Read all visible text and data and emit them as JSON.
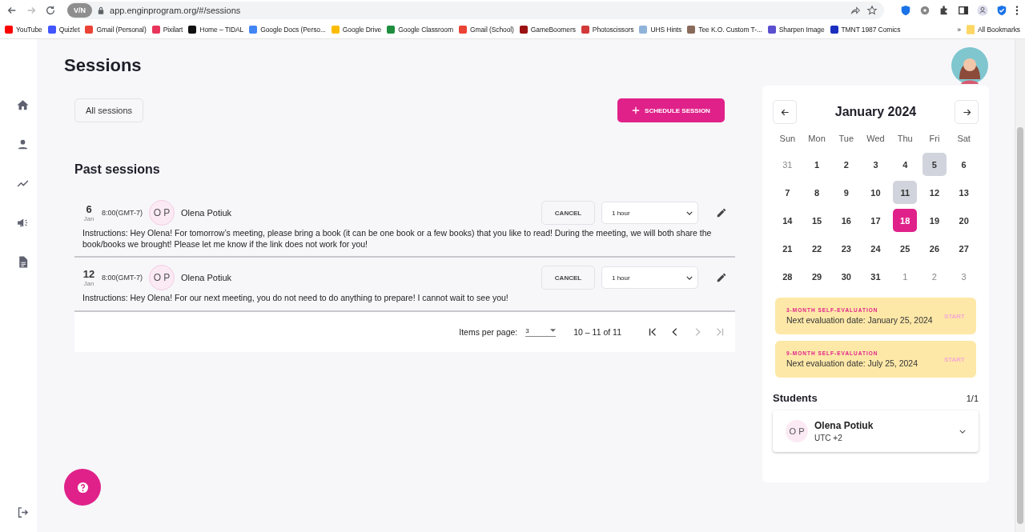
{
  "browser": {
    "url": "app.enginprogram.org/#/sessions",
    "vpn_badge": "V/N",
    "bookmarks": [
      {
        "label": "YouTube",
        "color": "#ff0000"
      },
      {
        "label": "Quizlet",
        "color": "#4255ff"
      },
      {
        "label": "Gmail (Personal)",
        "color": "#ea4335"
      },
      {
        "label": "Pixilart",
        "color": "#e8345a"
      },
      {
        "label": "Home – TIDAL",
        "color": "#111111"
      },
      {
        "label": "Google Docs (Perso...",
        "color": "#4285f4"
      },
      {
        "label": "Google Drive",
        "color": "#fbbc04"
      },
      {
        "label": "Google Classroom",
        "color": "#1e8e3e"
      },
      {
        "label": "Gmail (School)",
        "color": "#ea4335"
      },
      {
        "label": "GameBoomers",
        "color": "#9b1111"
      },
      {
        "label": "Photoscissors",
        "color": "#d23a3a"
      },
      {
        "label": "UHS Hints",
        "color": "#8fb3d9"
      },
      {
        "label": "Tee K.O. Custom T-...",
        "color": "#8a6a5a"
      },
      {
        "label": "Sharpen Image",
        "color": "#5a4fcf"
      },
      {
        "label": "TMNT 1987 Comics",
        "color": "#1a2fbf"
      }
    ],
    "overflow": "»",
    "all_bookmarks": "All Bookmarks"
  },
  "page": {
    "title": "Sessions"
  },
  "filter_button": "All sessions",
  "schedule_button": "SCHEDULE SESSION",
  "past_heading": "Past sessions",
  "sessions": [
    {
      "day": "6",
      "month": "Jan",
      "time": "8:00(GMT-7)",
      "initials": "O P",
      "name": "Olena Potiuk",
      "cancel": "CANCEL",
      "duration": "1 hour",
      "instructions": "Instructions: Hey Olena! For tomorrow’s meeting, please bring a book (it can be one book or a few books) that you like to read! During the meeting, we will both share the book/books we brought! Please let me know if the link does not work for you!"
    },
    {
      "day": "12",
      "month": "Jan",
      "time": "8:00(GMT-7)",
      "initials": "O P",
      "name": "Olena Potiuk",
      "cancel": "CANCEL",
      "duration": "1 hour",
      "instructions": "Instructions: Hey Olena! For our next meeting, you do not need to do anything to prepare! I cannot wait to see you!"
    }
  ],
  "pagination": {
    "label": "Items per page:",
    "per_page": "3",
    "range": "10 – 11 of 11"
  },
  "calendar": {
    "title": "January 2024",
    "weekdays": [
      "Sun",
      "Mon",
      "Tue",
      "Wed",
      "Thu",
      "Fri",
      "Sat"
    ],
    "days": [
      {
        "label": "31",
        "outside": true,
        "marked": false,
        "selected": false
      },
      {
        "label": "1",
        "outside": false,
        "marked": false,
        "selected": false
      },
      {
        "label": "2",
        "outside": false,
        "marked": false,
        "selected": false
      },
      {
        "label": "3",
        "outside": false,
        "marked": false,
        "selected": false
      },
      {
        "label": "4",
        "outside": false,
        "marked": false,
        "selected": false
      },
      {
        "label": "5",
        "outside": false,
        "marked": true,
        "selected": false
      },
      {
        "label": "6",
        "outside": false,
        "marked": false,
        "selected": false
      },
      {
        "label": "7",
        "outside": false,
        "marked": false,
        "selected": false
      },
      {
        "label": "8",
        "outside": false,
        "marked": false,
        "selected": false
      },
      {
        "label": "9",
        "outside": false,
        "marked": false,
        "selected": false
      },
      {
        "label": "10",
        "outside": false,
        "marked": false,
        "selected": false
      },
      {
        "label": "11",
        "outside": false,
        "marked": true,
        "selected": false
      },
      {
        "label": "12",
        "outside": false,
        "marked": false,
        "selected": false
      },
      {
        "label": "13",
        "outside": false,
        "marked": false,
        "selected": false
      },
      {
        "label": "14",
        "outside": false,
        "marked": false,
        "selected": false
      },
      {
        "label": "15",
        "outside": false,
        "marked": false,
        "selected": false
      },
      {
        "label": "16",
        "outside": false,
        "marked": false,
        "selected": false
      },
      {
        "label": "17",
        "outside": false,
        "marked": false,
        "selected": false
      },
      {
        "label": "18",
        "outside": false,
        "marked": false,
        "selected": true
      },
      {
        "label": "19",
        "outside": false,
        "marked": false,
        "selected": false
      },
      {
        "label": "20",
        "outside": false,
        "marked": false,
        "selected": false
      },
      {
        "label": "21",
        "outside": false,
        "marked": false,
        "selected": false
      },
      {
        "label": "22",
        "outside": false,
        "marked": false,
        "selected": false
      },
      {
        "label": "23",
        "outside": false,
        "marked": false,
        "selected": false
      },
      {
        "label": "24",
        "outside": false,
        "marked": false,
        "selected": false
      },
      {
        "label": "25",
        "outside": false,
        "marked": false,
        "selected": false
      },
      {
        "label": "26",
        "outside": false,
        "marked": false,
        "selected": false
      },
      {
        "label": "27",
        "outside": false,
        "marked": false,
        "selected": false
      },
      {
        "label": "28",
        "outside": false,
        "marked": false,
        "selected": false
      },
      {
        "label": "29",
        "outside": false,
        "marked": false,
        "selected": false
      },
      {
        "label": "30",
        "outside": false,
        "marked": false,
        "selected": false
      },
      {
        "label": "31",
        "outside": false,
        "marked": false,
        "selected": false
      },
      {
        "label": "1",
        "outside": true,
        "marked": false,
        "selected": false
      },
      {
        "label": "2",
        "outside": true,
        "marked": false,
        "selected": false
      },
      {
        "label": "3",
        "outside": true,
        "marked": false,
        "selected": false
      }
    ]
  },
  "evaluations": [
    {
      "kind_label": "3-MONTH SELF-EVALUATION",
      "date": "Next evaluation date: January 25, 2024",
      "action": "START"
    },
    {
      "kind_label": "9-MONTH SELF-EVALUATION",
      "date": "Next evaluation date: July 25, 2024",
      "action": "START"
    }
  ],
  "students": {
    "heading": "Students",
    "count": "1/1",
    "items": [
      {
        "initials": "O P",
        "name": "Olena Potiuk",
        "timezone": "UTC +2"
      }
    ]
  }
}
